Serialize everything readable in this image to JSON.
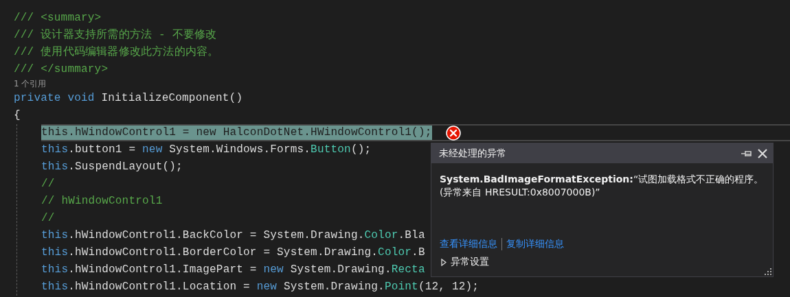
{
  "editor": {
    "lines": [
      {
        "kind": "code",
        "highlighted": false,
        "error": false,
        "tokens": [
          {
            "kind": "comment",
            "text": "/// <summary>"
          }
        ]
      },
      {
        "kind": "code",
        "highlighted": false,
        "error": false,
        "tokens": [
          {
            "kind": "comment",
            "text": "/// 设计器支持所需的方法 - 不要修改"
          }
        ]
      },
      {
        "kind": "code",
        "highlighted": false,
        "error": false,
        "tokens": [
          {
            "kind": "comment",
            "text": "/// 使用代码编辑器修改此方法的内容。"
          }
        ]
      },
      {
        "kind": "code",
        "highlighted": false,
        "error": false,
        "tokens": [
          {
            "kind": "comment",
            "text": "/// </summary>"
          }
        ]
      },
      {
        "kind": "codelens",
        "text": "1 个引用"
      },
      {
        "kind": "code",
        "highlighted": false,
        "error": false,
        "tokens": [
          {
            "kind": "keyword",
            "text": "private void"
          },
          {
            "kind": "plain",
            "text": " InitializeComponent()"
          }
        ]
      },
      {
        "kind": "code",
        "highlighted": false,
        "error": false,
        "tokens": [
          {
            "kind": "plain",
            "text": "{"
          }
        ],
        "children": [
          {
            "kind": "code",
            "highlighted": true,
            "error": true,
            "tokens": [
              {
                "kind": "keyword",
                "text": "this"
              },
              {
                "kind": "plain",
                "text": ".hWindowControl1 = "
              },
              {
                "kind": "keyword",
                "text": "new"
              },
              {
                "kind": "plain",
                "text": " HalconDotNet.HWindowControl1();"
              }
            ]
          },
          {
            "kind": "code",
            "highlighted": false,
            "error": false,
            "tokens": [
              {
                "kind": "keyword",
                "text": "this"
              },
              {
                "kind": "plain",
                "text": ".button1 = "
              },
              {
                "kind": "keyword",
                "text": "new"
              },
              {
                "kind": "plain",
                "text": " System.Windows.Forms."
              },
              {
                "kind": "type",
                "text": "Button"
              },
              {
                "kind": "plain",
                "text": "();"
              }
            ]
          },
          {
            "kind": "code",
            "highlighted": false,
            "error": false,
            "tokens": [
              {
                "kind": "keyword",
                "text": "this"
              },
              {
                "kind": "plain",
                "text": ".SuspendLayout();"
              }
            ]
          },
          {
            "kind": "code",
            "highlighted": false,
            "error": false,
            "tokens": [
              {
                "kind": "comment",
                "text": "//"
              }
            ]
          },
          {
            "kind": "code",
            "highlighted": false,
            "error": false,
            "tokens": [
              {
                "kind": "comment",
                "text": "// hWindowControl1"
              }
            ]
          },
          {
            "kind": "code",
            "highlighted": false,
            "error": false,
            "tokens": [
              {
                "kind": "comment",
                "text": "//"
              }
            ]
          },
          {
            "kind": "code",
            "highlighted": false,
            "error": false,
            "tokens": [
              {
                "kind": "keyword",
                "text": "this"
              },
              {
                "kind": "plain",
                "text": ".hWindowControl1.BackColor = System.Drawing."
              },
              {
                "kind": "type",
                "text": "Color"
              },
              {
                "kind": "plain",
                "text": ".Bla"
              }
            ]
          },
          {
            "kind": "code",
            "highlighted": false,
            "error": false,
            "tokens": [
              {
                "kind": "keyword",
                "text": "this"
              },
              {
                "kind": "plain",
                "text": ".hWindowControl1.BorderColor = System.Drawing."
              },
              {
                "kind": "type",
                "text": "Color"
              },
              {
                "kind": "plain",
                "text": ".B"
              }
            ]
          },
          {
            "kind": "code",
            "highlighted": false,
            "error": false,
            "tokens": [
              {
                "kind": "keyword",
                "text": "this"
              },
              {
                "kind": "plain",
                "text": ".hWindowControl1.ImagePart = "
              },
              {
                "kind": "keyword",
                "text": "new"
              },
              {
                "kind": "plain",
                "text": " System.Drawing."
              },
              {
                "kind": "type",
                "text": "Recta"
              }
            ]
          },
          {
            "kind": "code",
            "highlighted": false,
            "error": false,
            "tokens": [
              {
                "kind": "keyword",
                "text": "this"
              },
              {
                "kind": "plain",
                "text": ".hWindowControl1.Location = "
              },
              {
                "kind": "keyword",
                "text": "new"
              },
              {
                "kind": "plain",
                "text": " System.Drawing."
              },
              {
                "kind": "type",
                "text": "Point"
              },
              {
                "kind": "plain",
                "text": "(12, 12);"
              }
            ]
          }
        ]
      }
    ]
  },
  "exception_popup": {
    "title": "未经处理的异常",
    "message": "**System.BadImageFormatException:**“试图加载格式不正确的程序。(异常来自 HRESULT:0x8007000B)”",
    "links": [
      "查看详细信息",
      "复制详细信息"
    ],
    "settings": {
      "label": "异常设置",
      "expanded": false
    }
  }
}
